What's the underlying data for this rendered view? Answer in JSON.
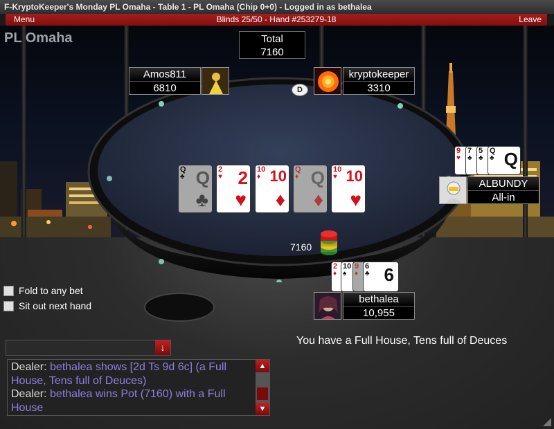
{
  "window_title": "F-KryptoKeeper's Monday PL Omaha - Table 1 - PL Omaha (Chip 0+0) - Logged in as bethalea",
  "menubar": {
    "menu_label": "Menu",
    "center_text": "Blinds 25/50 - Hand #253279-18",
    "leave_label": "Leave"
  },
  "brand": "PL Omaha",
  "pot": {
    "total_label": "Total",
    "total_value": "7160",
    "table_amount": "7160"
  },
  "dealer_button": "D",
  "seats": [
    {
      "name": "Amos811",
      "stack": "6810"
    },
    {
      "name": "kryptokeeper",
      "stack": "3310"
    },
    {
      "name": "ALBUNDY",
      "stack": "All-in",
      "hole_cards": [
        "9h",
        "7c",
        "5c",
        "Qc"
      ]
    },
    {
      "name": "bethalea",
      "stack": "10,955",
      "hole_cards": [
        "2d",
        "Ts",
        "9d",
        "6c"
      ]
    }
  ],
  "board": [
    {
      "rank": "Q",
      "suit": "♣",
      "color": "black",
      "faded": true
    },
    {
      "rank": "2",
      "suit": "♥",
      "color": "red",
      "faded": false
    },
    {
      "rank": "10",
      "suit": "♦",
      "color": "red",
      "faded": false
    },
    {
      "rank": "Q",
      "suit": "♦",
      "color": "red",
      "faded": true
    },
    {
      "rank": "10",
      "suit": "♥",
      "color": "red",
      "faded": false
    }
  ],
  "albundy_cards": [
    {
      "rank": "9",
      "suit": "♥",
      "color": "red"
    },
    {
      "rank": "7",
      "suit": "♣",
      "color": "black"
    },
    {
      "rank": "5",
      "suit": "♣",
      "color": "black"
    },
    {
      "rank": "Q",
      "suit": "♣",
      "color": "black"
    }
  ],
  "bethalea_cards": [
    {
      "rank": "2",
      "suit": "♦",
      "color": "red"
    },
    {
      "rank": "10",
      "suit": "♠",
      "color": "black"
    },
    {
      "rank": "9",
      "suit": "♦",
      "color": "red"
    },
    {
      "rank": "6",
      "suit": "♣",
      "color": "black"
    }
  ],
  "options": {
    "fold_label": "Fold to any bet",
    "sitout_label": "Sit out next hand"
  },
  "hand_message": "You have a Full House, Tens full of Deuces",
  "chat": {
    "lines": [
      {
        "who": "Dealer:",
        "text": "bethalea shows [2d Ts 9d 6c] (a Full House, Tens full of Deuces)"
      },
      {
        "who": "Dealer:",
        "text": "bethalea wins Pot (7160) with a Full House"
      }
    ]
  },
  "icons": {
    "dropdown": "arrow-down-icon",
    "scroll_up": "triangle-up-icon",
    "scroll_down": "triangle-down-icon"
  },
  "colors": {
    "accent_red": "#a81b1b",
    "chat_message": "#8f7fe0",
    "felt": "#2b3344"
  }
}
